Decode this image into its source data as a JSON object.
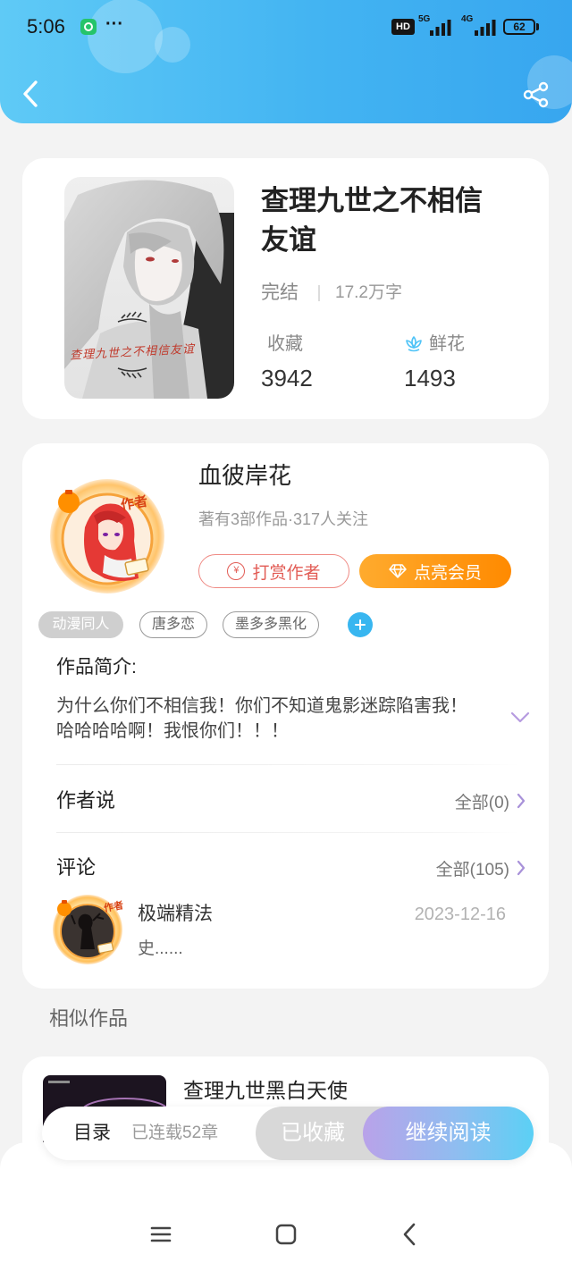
{
  "status_bar": {
    "time": "5:06",
    "more": "···",
    "hd": "HD",
    "net1": "5G",
    "net2": "4G",
    "battery": "62"
  },
  "header": {
    "back_icon": "chevron-left-icon",
    "share_icon": "share-icon"
  },
  "book": {
    "cover_caption": "查理九世之不相信友谊",
    "title": "查理九世之不相信友谊",
    "status": "完结",
    "word_count": "17.2万字",
    "favorites_label": "收藏",
    "favorites_count": "3942",
    "flowers_label": "鲜花",
    "flowers_icon": "flower-icon",
    "flowers_count": "1493"
  },
  "author": {
    "avatar_badge": "作者",
    "name": "血彼岸花",
    "meta": "著有3部作品·317人关注",
    "tip_icon_glyph": "¥",
    "tip_button": "打赏作者",
    "vip_icon": "diamond-icon",
    "vip_button": "点亮会员"
  },
  "tags": [
    "动漫同人",
    "唐多恋",
    "墨多多黑化"
  ],
  "tags_add_icon": "plus-icon",
  "synopsis": {
    "label": "作品简介:",
    "text": "为什么你们不相信我！你们不知道鬼影迷踪陷害我！哈哈哈哈啊！我恨你们！！！",
    "expand_icon": "chevron-down-icon"
  },
  "author_says": {
    "label": "作者说",
    "all": "全部(0)"
  },
  "comments": {
    "label": "评论",
    "all": "全部(105)",
    "items": [
      {
        "avatar_badge": "作者",
        "user": "极端精法",
        "date": "2023-12-16",
        "text": "史......"
      }
    ]
  },
  "similar": {
    "label": "相似作品",
    "items": [
      {
        "title": "查理九世黑白天使"
      }
    ]
  },
  "bottom_bar": {
    "toc": "目录",
    "chapters": "已连载52章",
    "collected": "已收藏",
    "continue": "继续阅读"
  },
  "nav_bar": {
    "menu_icon": "menu-icon",
    "home_icon": "square-home-icon",
    "back_icon": "back-chevron-icon"
  },
  "colors": {
    "header_start": "#5fcaf6",
    "header_end": "#37a6ef",
    "tip_red": "#e25c55",
    "vip_orange": "#ff8a00",
    "continue_gradient_start": "#b9a2e9",
    "continue_gradient_end": "#5bd0f5",
    "accent_purple": "#a891d9",
    "page_bg": "#f3f3f3"
  }
}
